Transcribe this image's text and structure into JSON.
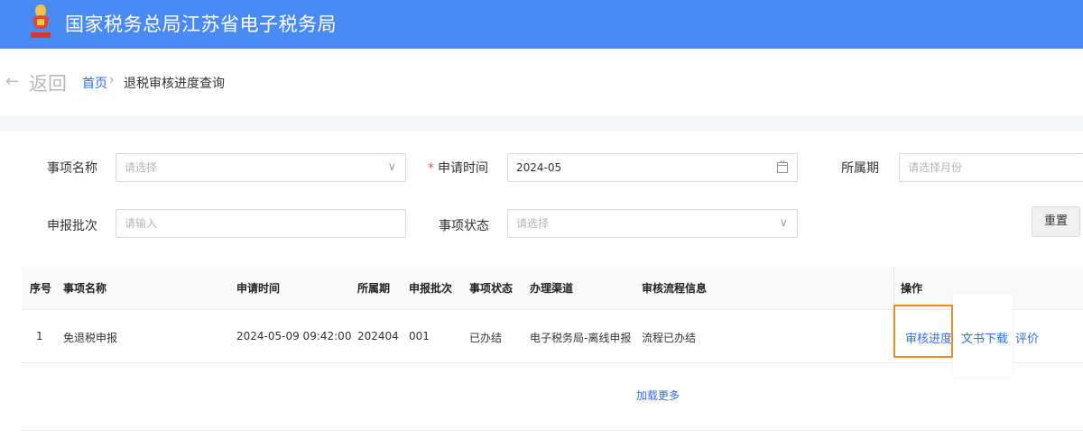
{
  "header": {
    "title": "国家税务总局江苏省电子税务局"
  },
  "nav": {
    "back_arrow": "←",
    "back_label": "返回",
    "breadcrumb_home": "首页",
    "breadcrumb_sep": "›",
    "breadcrumb_current": "退税审核进度查询"
  },
  "filters": {
    "item_name": {
      "label": "事项名称",
      "placeholder": "请选择"
    },
    "apply_time": {
      "required_mark": "*",
      "label": "申请时间",
      "value": "2024-05"
    },
    "period": {
      "label": "所属期",
      "placeholder": "请选择月份"
    },
    "batch": {
      "label": "申报批次",
      "placeholder": "请输入"
    },
    "status": {
      "label": "事项状态",
      "placeholder": "请选择"
    },
    "reset_label": "重置",
    "chevron": "∨"
  },
  "table": {
    "headers": [
      "序号",
      "事项名称",
      "申请时间",
      "所属期",
      "申报批次",
      "事项状态",
      "办理渠道",
      "审核流程信息",
      "操作"
    ],
    "rows": [
      {
        "index": "1",
        "item": "免退税申报",
        "apply_time": "2024-05-09 09:42:00",
        "period": "202404",
        "batch": "001",
        "status": "已办结",
        "channel": "电子税务局-离线申报",
        "flow_info": "流程已办结",
        "actions": {
          "progress": "审核进度",
          "download": "文书下载",
          "rate": "评价"
        }
      }
    ],
    "load_more": "加载更多"
  },
  "colors": {
    "header_bg": "#4a8af4",
    "link": "#2f6fe8",
    "highlight": "#f08a24"
  }
}
